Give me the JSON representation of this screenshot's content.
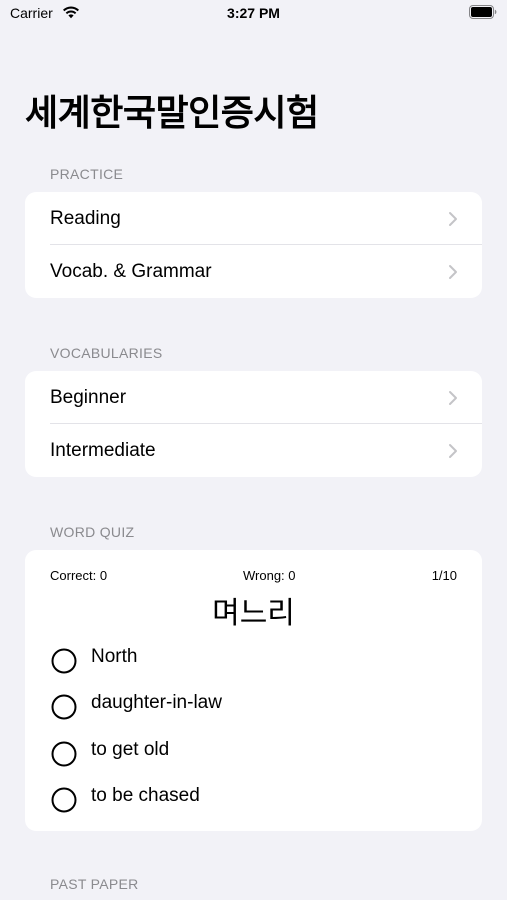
{
  "status_bar": {
    "carrier": "Carrier",
    "time": "3:27 PM",
    "wifi_icon": "wifi-icon",
    "battery_icon": "battery-icon"
  },
  "title": "세계한국말인증시험",
  "practice": {
    "header": "PRACTICE",
    "items": [
      {
        "label": "Reading",
        "icon": "chevron-right-icon"
      },
      {
        "label": "Vocab. & Grammar",
        "icon": "chevron-right-icon"
      }
    ]
  },
  "vocabularies": {
    "header": "VOCABULARIES",
    "items": [
      {
        "label": "Beginner",
        "icon": "chevron-right-icon"
      },
      {
        "label": "Intermediate",
        "icon": "chevron-right-icon"
      }
    ]
  },
  "word_quiz": {
    "header": "WORD QUIZ",
    "correct": "Correct: 0",
    "wrong": "Wrong: 0",
    "progress": "1/10",
    "word": "며느리",
    "options": [
      {
        "label": "North",
        "icon": "radio-empty-icon"
      },
      {
        "label": "daughter-in-law",
        "icon": "radio-empty-icon"
      },
      {
        "label": "to get old",
        "icon": "radio-empty-icon"
      },
      {
        "label": "to be chased",
        "icon": "radio-empty-icon"
      }
    ]
  },
  "past_paper": {
    "header": "PAST PAPER"
  }
}
